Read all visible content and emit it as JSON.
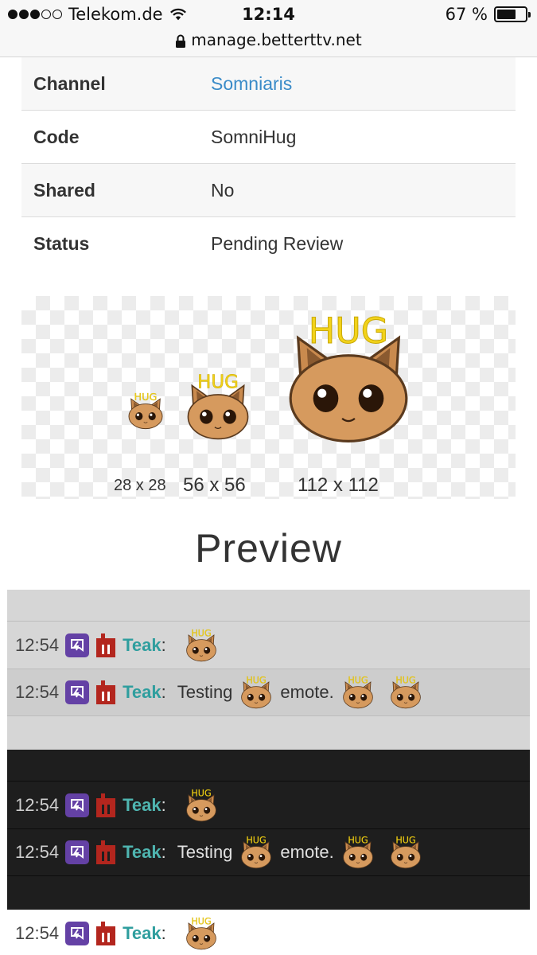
{
  "status_bar": {
    "carrier": "Telekom.de",
    "time": "12:14",
    "battery": "67 %",
    "battery_level": 0.67
  },
  "url_bar": {
    "url": "manage.betterttv.net"
  },
  "info_table": [
    {
      "key": "Channel",
      "value": "Somniaris"
    },
    {
      "key": "Code",
      "value": "SomniHug"
    },
    {
      "key": "Shared",
      "value": "No"
    },
    {
      "key": "Status",
      "value": "Pending Review"
    }
  ],
  "emote": {
    "overlay_text": "HUG",
    "sizes": [
      "28 x 28",
      "56 x 56",
      "112 x 112"
    ]
  },
  "preview": {
    "title": "Preview"
  },
  "chat": {
    "timestamp": "12:54",
    "username": "Teak",
    "colon": ":",
    "message_before": "Testing",
    "message_after": "emote."
  },
  "colors": {
    "link": "#3a8bc8",
    "username": "#2f9e9e",
    "prime_badge": "#6441a5",
    "bits_badge": "#b3261e",
    "hug_text": "#f2d21a"
  }
}
